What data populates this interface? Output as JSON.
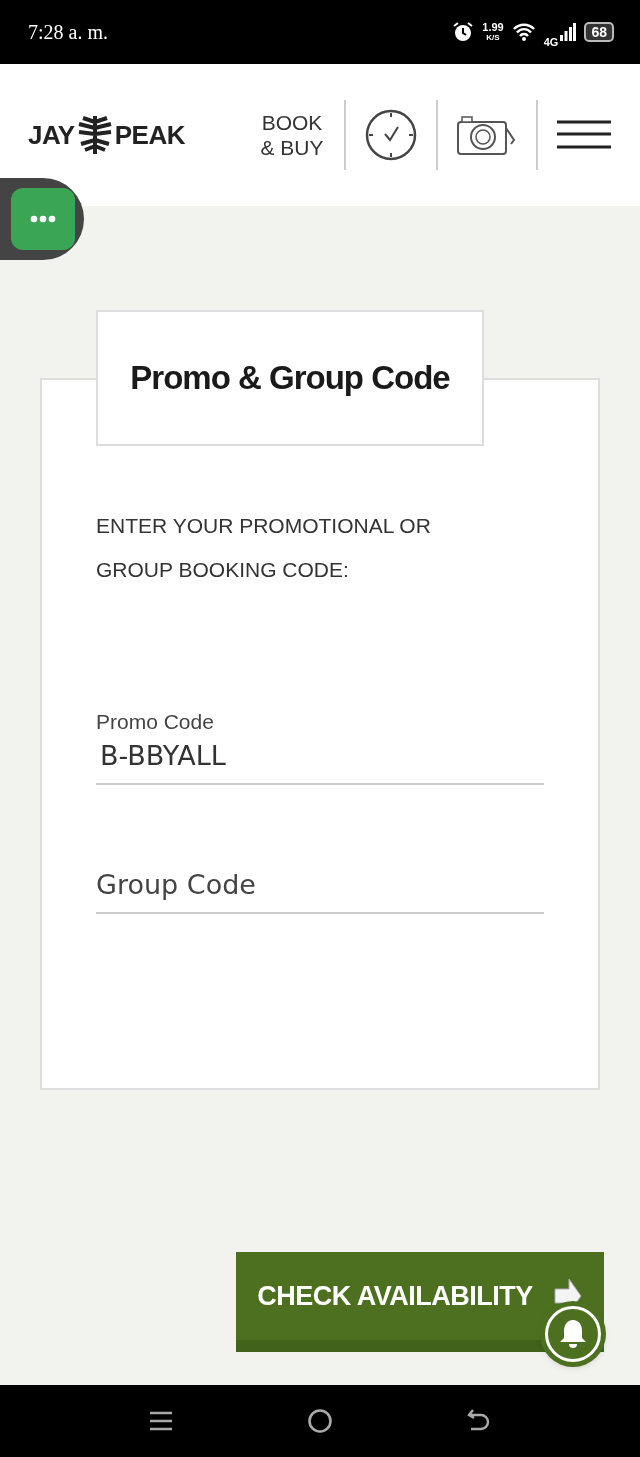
{
  "status_bar": {
    "time": "7:28 a. m.",
    "speed": "1.99",
    "speed_unit": "K/S",
    "network": "4G",
    "battery": "68"
  },
  "header": {
    "logo_left": "JAY",
    "logo_right": "PEAK",
    "book_link": "BOOK & BUY"
  },
  "panel": {
    "title": "Promo & Group Code",
    "instruction": "ENTER YOUR PROMOTIONAL OR GROUP BOOKING CODE:",
    "fields": [
      {
        "label": "Promo Code",
        "value": "B-BBYALL"
      },
      {
        "placeholder": "Group Code"
      }
    ]
  },
  "button": {
    "label": "CHECK AVAILABILITY"
  }
}
